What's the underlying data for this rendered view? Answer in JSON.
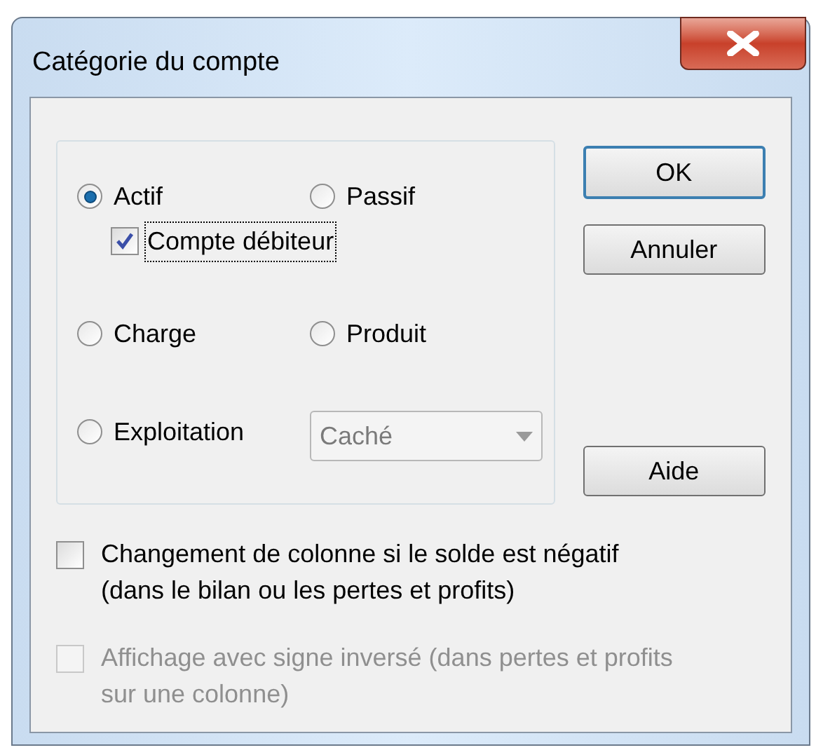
{
  "window": {
    "title": "Catégorie du compte"
  },
  "radios": [
    {
      "label": "Actif",
      "selected": true
    },
    {
      "label": "Passif",
      "selected": false
    },
    {
      "label": "Charge",
      "selected": false
    },
    {
      "label": "Produit",
      "selected": false
    },
    {
      "label": "Exploitation",
      "selected": false
    }
  ],
  "sub_checkbox": {
    "label": "Compte débiteur",
    "checked": true,
    "focused": true
  },
  "dropdown": {
    "value": "Caché",
    "disabled": true
  },
  "buttons": [
    {
      "label": "OK",
      "default": true
    },
    {
      "label": "Annuler",
      "default": false
    },
    {
      "label": "Aide",
      "default": false
    }
  ],
  "options": [
    {
      "label": "Changement de colonne si le solde est négatif (dans le bilan ou les pertes et profits)",
      "checked": false,
      "disabled": false
    },
    {
      "label": "Affichage avec signe inversé (dans pertes et profits sur une colonne)",
      "checked": false,
      "disabled": true
    }
  ]
}
